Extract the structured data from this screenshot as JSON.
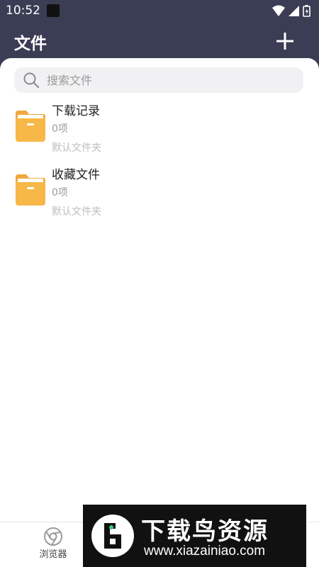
{
  "status_bar": {
    "time": "10:52"
  },
  "header": {
    "title": "文件",
    "add_icon": "plus-icon"
  },
  "search": {
    "placeholder": "搜索文件",
    "value": ""
  },
  "folders": [
    {
      "name": "下载记录",
      "count": "0项",
      "description": "默认文件夹"
    },
    {
      "name": "收藏文件",
      "count": "0项",
      "description": "默认文件夹"
    }
  ],
  "bottom_nav": {
    "browser_label": "浏览器"
  },
  "watermark": {
    "title": "下载鸟资源",
    "url": "www.xiazainiao.com"
  },
  "colors": {
    "header_bg": "#3b3d54",
    "folder_yellow": "#f7b848",
    "search_bg": "#f1f1f3",
    "text_primary": "#222222",
    "text_secondary": "#9b9b9b"
  }
}
